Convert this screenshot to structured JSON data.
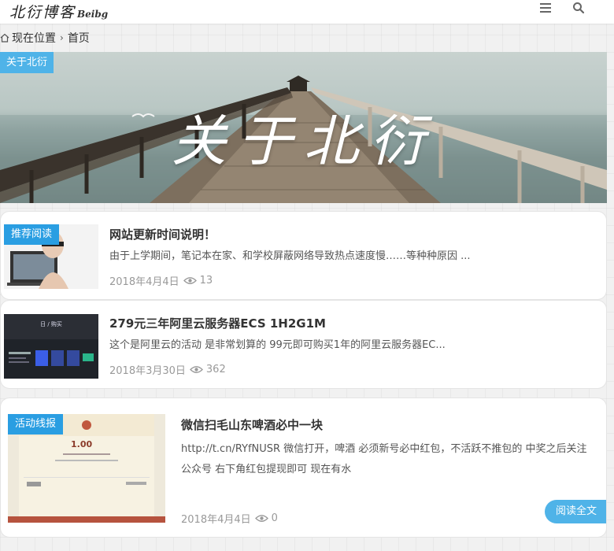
{
  "header": {
    "logo_text": "北衍博客",
    "logo_en": "Beibg"
  },
  "breadcrumb": {
    "current_label": "现在位置",
    "home_label": "首页"
  },
  "banner": {
    "tag": "关于北衍",
    "title": "关于北衍"
  },
  "posts": [
    {
      "tag": "推荐阅读",
      "title": "网站更新时间说明！",
      "excerpt": "由于上学期间，笔记本在家、和学校屏蔽网络导致热点速度慢……等种种原因 ...",
      "date": "2018年4月4日",
      "views": "13"
    },
    {
      "tag": "",
      "title": "279元三年阿里云服务器ECS 1H2G1M",
      "excerpt": "这个是阿里云的活动 是非常划算的 99元即可购买1年的阿里云服务器EC...",
      "date": "2018年3月30日",
      "views": "362",
      "thumb_caption": "日 / 购买"
    },
    {
      "tag": "活动线报",
      "title": "微信扫毛山东啤酒必中一块",
      "excerpt": "http://t.cn/RYfNUSR 微信打开，啤酒 必须新号必中红包，不活跃不推包的 中奖之后关注公众号 右下角红包提现即可 现在有水",
      "date": "2018年4月4日",
      "views": "0",
      "read_more": "阅读全文",
      "thumb_amount": "1.00"
    }
  ],
  "colors": {
    "accent": "#4fb3e8",
    "tag_blue": "#2a9ee2"
  }
}
